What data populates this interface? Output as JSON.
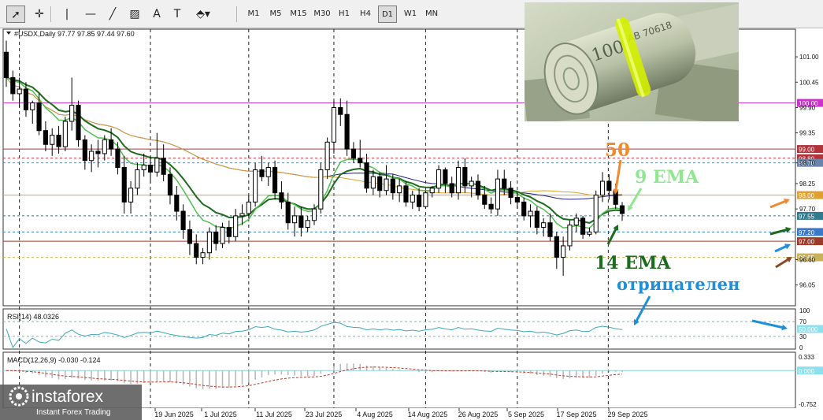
{
  "toolbar": {
    "tools": [
      {
        "name": "cursor-arrow-icon",
        "glyph": "➚"
      },
      {
        "name": "crosshair-icon",
        "glyph": "✛"
      },
      {
        "name": "vertical-line-icon",
        "glyph": "|"
      },
      {
        "name": "horizontal-line-icon",
        "glyph": "—"
      },
      {
        "name": "trendline-icon",
        "glyph": "╱"
      },
      {
        "name": "channel-icon",
        "glyph": "▨"
      },
      {
        "name": "text-tool-icon",
        "glyph": "A"
      },
      {
        "name": "text-label-icon",
        "glyph": "T"
      },
      {
        "name": "shapes-menu-icon",
        "glyph": "⬘▾"
      }
    ],
    "timeframes": [
      "M1",
      "M5",
      "M15",
      "M30",
      "H1",
      "H4",
      "D1",
      "W1",
      "MN"
    ],
    "active_timeframe": "D1"
  },
  "chart_data": {
    "type": "candlestick",
    "symbol_header": "#USDX,Daily  97.77 97.85 97.44 97.60",
    "ylim": [
      95.6,
      101.6
    ],
    "y_ticks": [
      {
        "value": 101.0,
        "label": "101.00"
      },
      {
        "value": 100.45,
        "label": "100.45"
      },
      {
        "value": 99.9,
        "label": "99.90"
      },
      {
        "value": 99.35,
        "label": "99.35"
      },
      {
        "value": 98.7,
        "label": "98.70"
      },
      {
        "value": 98.25,
        "label": "98.25"
      },
      {
        "value": 97.7,
        "label": "97.70"
      },
      {
        "value": 96.6,
        "label": "96.60"
      },
      {
        "value": 96.05,
        "label": "96.05"
      }
    ],
    "x_labels": [
      "19 Jun 2025",
      "1 Jul 2025",
      "11 Jul 2025",
      "23 Jul 2025",
      "4 Aug 2025",
      "14 Aug 2025",
      "26 Aug 2025",
      "5 Sep 2025",
      "17 Sep 2025",
      "29 Sep 2025"
    ],
    "levels": [
      {
        "value": 100.0,
        "label": "100.00",
        "color": "#cc33cc",
        "style": "solid"
      },
      {
        "value": 99.0,
        "label": "99.00",
        "color": "#b0333a",
        "style": "solid"
      },
      {
        "value": 98.8,
        "label": "98.80",
        "color": "#b0333a",
        "style": "dotted"
      },
      {
        "value": 98.7,
        "label": "98.70",
        "color": "#6a84ab",
        "style": "dotted"
      },
      {
        "value": 98.0,
        "label": "98.00",
        "color": "#e0a030",
        "style": "solid"
      },
      {
        "value": 97.55,
        "label": "97.55",
        "color": "#2f7a8f",
        "style": "dotted"
      },
      {
        "value": 97.2,
        "label": "97.20",
        "color": "#3a78c8",
        "style": "dotted"
      },
      {
        "value": 97.0,
        "label": "97.00",
        "color": "#9b3b2a",
        "style": "solid"
      },
      {
        "value": 96.65,
        "label": "96.65",
        "color": "#c9b35a",
        "style": "dotted"
      }
    ],
    "candles": [
      [
        101.1,
        101.35,
        100.35,
        100.55
      ],
      [
        100.55,
        100.7,
        100.05,
        100.2
      ],
      [
        100.2,
        100.55,
        99.9,
        100.3
      ],
      [
        100.3,
        100.45,
        99.7,
        99.85
      ],
      [
        99.85,
        100.05,
        99.55,
        100.0
      ],
      [
        100.0,
        100.2,
        99.3,
        99.4
      ],
      [
        99.4,
        99.6,
        98.95,
        99.1
      ],
      [
        99.1,
        99.45,
        98.85,
        99.3
      ],
      [
        99.3,
        99.5,
        98.9,
        99.05
      ],
      [
        99.05,
        99.7,
        98.95,
        99.6
      ],
      [
        99.6,
        100.55,
        99.4,
        99.95
      ],
      [
        99.95,
        100.05,
        99.05,
        99.2
      ],
      [
        99.2,
        99.3,
        98.55,
        98.75
      ],
      [
        98.75,
        99.1,
        98.5,
        98.95
      ],
      [
        98.95,
        99.2,
        98.6,
        98.9
      ],
      [
        98.9,
        99.3,
        98.75,
        99.2
      ],
      [
        99.2,
        99.45,
        98.85,
        99.0
      ],
      [
        99.0,
        99.15,
        98.45,
        98.6
      ],
      [
        98.6,
        98.85,
        97.6,
        97.85
      ],
      [
        97.85,
        98.3,
        97.6,
        98.15
      ],
      [
        98.15,
        98.7,
        98.0,
        98.55
      ],
      [
        98.55,
        98.9,
        98.4,
        98.65
      ],
      [
        98.65,
        98.85,
        98.25,
        98.5
      ],
      [
        98.5,
        99.35,
        98.4,
        98.8
      ],
      [
        98.8,
        99.1,
        98.3,
        98.45
      ],
      [
        98.45,
        98.6,
        97.8,
        98.0
      ],
      [
        98.0,
        98.2,
        97.45,
        97.65
      ],
      [
        97.65,
        97.8,
        97.05,
        97.25
      ],
      [
        97.25,
        97.45,
        96.7,
        96.95
      ],
      [
        96.95,
        97.15,
        96.5,
        96.65
      ],
      [
        96.65,
        96.85,
        96.5,
        96.75
      ],
      [
        96.75,
        97.3,
        96.6,
        97.2
      ],
      [
        97.2,
        97.35,
        96.8,
        96.95
      ],
      [
        96.95,
        97.4,
        96.85,
        97.3
      ],
      [
        97.3,
        97.45,
        96.95,
        97.1
      ],
      [
        97.1,
        97.7,
        97.0,
        97.55
      ],
      [
        97.55,
        97.8,
        97.35,
        97.6
      ],
      [
        97.6,
        98.0,
        97.5,
        97.85
      ],
      [
        97.85,
        98.7,
        97.75,
        98.55
      ],
      [
        98.55,
        98.85,
        98.3,
        98.4
      ],
      [
        98.4,
        98.7,
        98.2,
        98.6
      ],
      [
        98.6,
        98.75,
        97.9,
        98.05
      ],
      [
        98.05,
        98.3,
        97.7,
        97.85
      ],
      [
        97.85,
        98.05,
        97.25,
        97.4
      ],
      [
        97.4,
        97.75,
        97.1,
        97.55
      ],
      [
        97.55,
        97.75,
        97.1,
        97.3
      ],
      [
        97.3,
        97.55,
        97.2,
        97.45
      ],
      [
        97.45,
        97.8,
        97.35,
        97.7
      ],
      [
        97.7,
        98.7,
        97.6,
        98.55
      ],
      [
        98.55,
        99.25,
        98.35,
        99.15
      ],
      [
        99.15,
        100.05,
        98.9,
        99.9
      ],
      [
        99.9,
        100.1,
        99.5,
        99.75
      ],
      [
        99.75,
        100.05,
        98.85,
        99.0
      ],
      [
        99.0,
        99.15,
        98.7,
        98.8
      ],
      [
        98.8,
        99.2,
        98.6,
        98.7
      ],
      [
        98.7,
        98.9,
        98.05,
        98.15
      ],
      [
        98.15,
        98.55,
        98.0,
        98.4
      ],
      [
        98.4,
        98.5,
        97.95,
        98.1
      ],
      [
        98.1,
        98.65,
        98.0,
        98.35
      ],
      [
        98.35,
        98.45,
        97.9,
        98.05
      ],
      [
        98.05,
        98.35,
        97.85,
        98.2
      ],
      [
        98.2,
        98.3,
        97.75,
        97.85
      ],
      [
        97.85,
        98.1,
        97.7,
        98.0
      ],
      [
        98.0,
        98.15,
        97.65,
        97.75
      ],
      [
        97.75,
        98.1,
        97.7,
        98.05
      ],
      [
        98.05,
        98.2,
        97.95,
        98.15
      ],
      [
        98.15,
        98.65,
        98.05,
        98.55
      ],
      [
        98.55,
        98.6,
        98.05,
        98.25
      ],
      [
        98.25,
        98.4,
        97.95,
        98.05
      ],
      [
        98.05,
        98.75,
        97.9,
        98.6
      ],
      [
        98.6,
        98.8,
        98.05,
        98.2
      ],
      [
        98.2,
        98.4,
        97.95,
        98.3
      ],
      [
        98.3,
        98.45,
        97.9,
        98.0
      ],
      [
        98.0,
        98.2,
        97.7,
        97.8
      ],
      [
        97.8,
        97.95,
        97.6,
        97.7
      ],
      [
        97.7,
        98.55,
        97.55,
        98.35
      ],
      [
        98.35,
        98.55,
        98.0,
        98.15
      ],
      [
        98.15,
        98.3,
        97.8,
        97.95
      ],
      [
        97.95,
        98.05,
        97.7,
        97.85
      ],
      [
        97.85,
        97.95,
        97.45,
        97.55
      ],
      [
        97.55,
        97.8,
        97.3,
        97.65
      ],
      [
        97.65,
        97.75,
        97.15,
        97.3
      ],
      [
        97.3,
        97.5,
        97.1,
        97.4
      ],
      [
        97.4,
        97.6,
        97.0,
        97.1
      ],
      [
        97.1,
        97.2,
        96.4,
        96.65
      ],
      [
        96.65,
        97.1,
        96.25,
        96.9
      ],
      [
        96.9,
        97.45,
        96.8,
        97.35
      ],
      [
        97.35,
        97.6,
        97.2,
        97.5
      ],
      [
        97.5,
        97.55,
        97.05,
        97.15
      ],
      [
        97.15,
        97.3,
        97.1,
        97.2
      ],
      [
        97.2,
        98.1,
        97.15,
        98.0
      ],
      [
        98.0,
        98.5,
        97.85,
        98.3
      ],
      [
        98.3,
        98.45,
        97.9,
        98.1
      ],
      [
        98.1,
        98.25,
        97.7,
        97.8
      ],
      [
        97.77,
        97.85,
        97.44,
        97.6
      ]
    ],
    "indicators": {
      "rsi": {
        "label": "RSI(14) 48.0326",
        "scale": [
          0,
          100
        ],
        "ticks": [
          "100",
          "70",
          "30",
          "0"
        ],
        "levels": [
          70,
          30
        ],
        "marked_level": "50.000"
      },
      "macd": {
        "label": "MACD(12,26,9) -0.030 -0.124",
        "ticks": [
          "0.333",
          "0.000",
          "-0.752"
        ],
        "range": [
          -0.752,
          0.333
        ]
      }
    },
    "annotations": [
      {
        "text": "50",
        "color": "#f08a2c"
      },
      {
        "text": "9 EMA",
        "color": "#8fe88f"
      },
      {
        "text": "14 EMA",
        "color": "#1d6b1d"
      },
      {
        "text": "отрицателен",
        "color": "#1e8fd8"
      }
    ],
    "watermark": {
      "brand": "instaforex",
      "tagline": "Instant Forex Trading"
    }
  }
}
